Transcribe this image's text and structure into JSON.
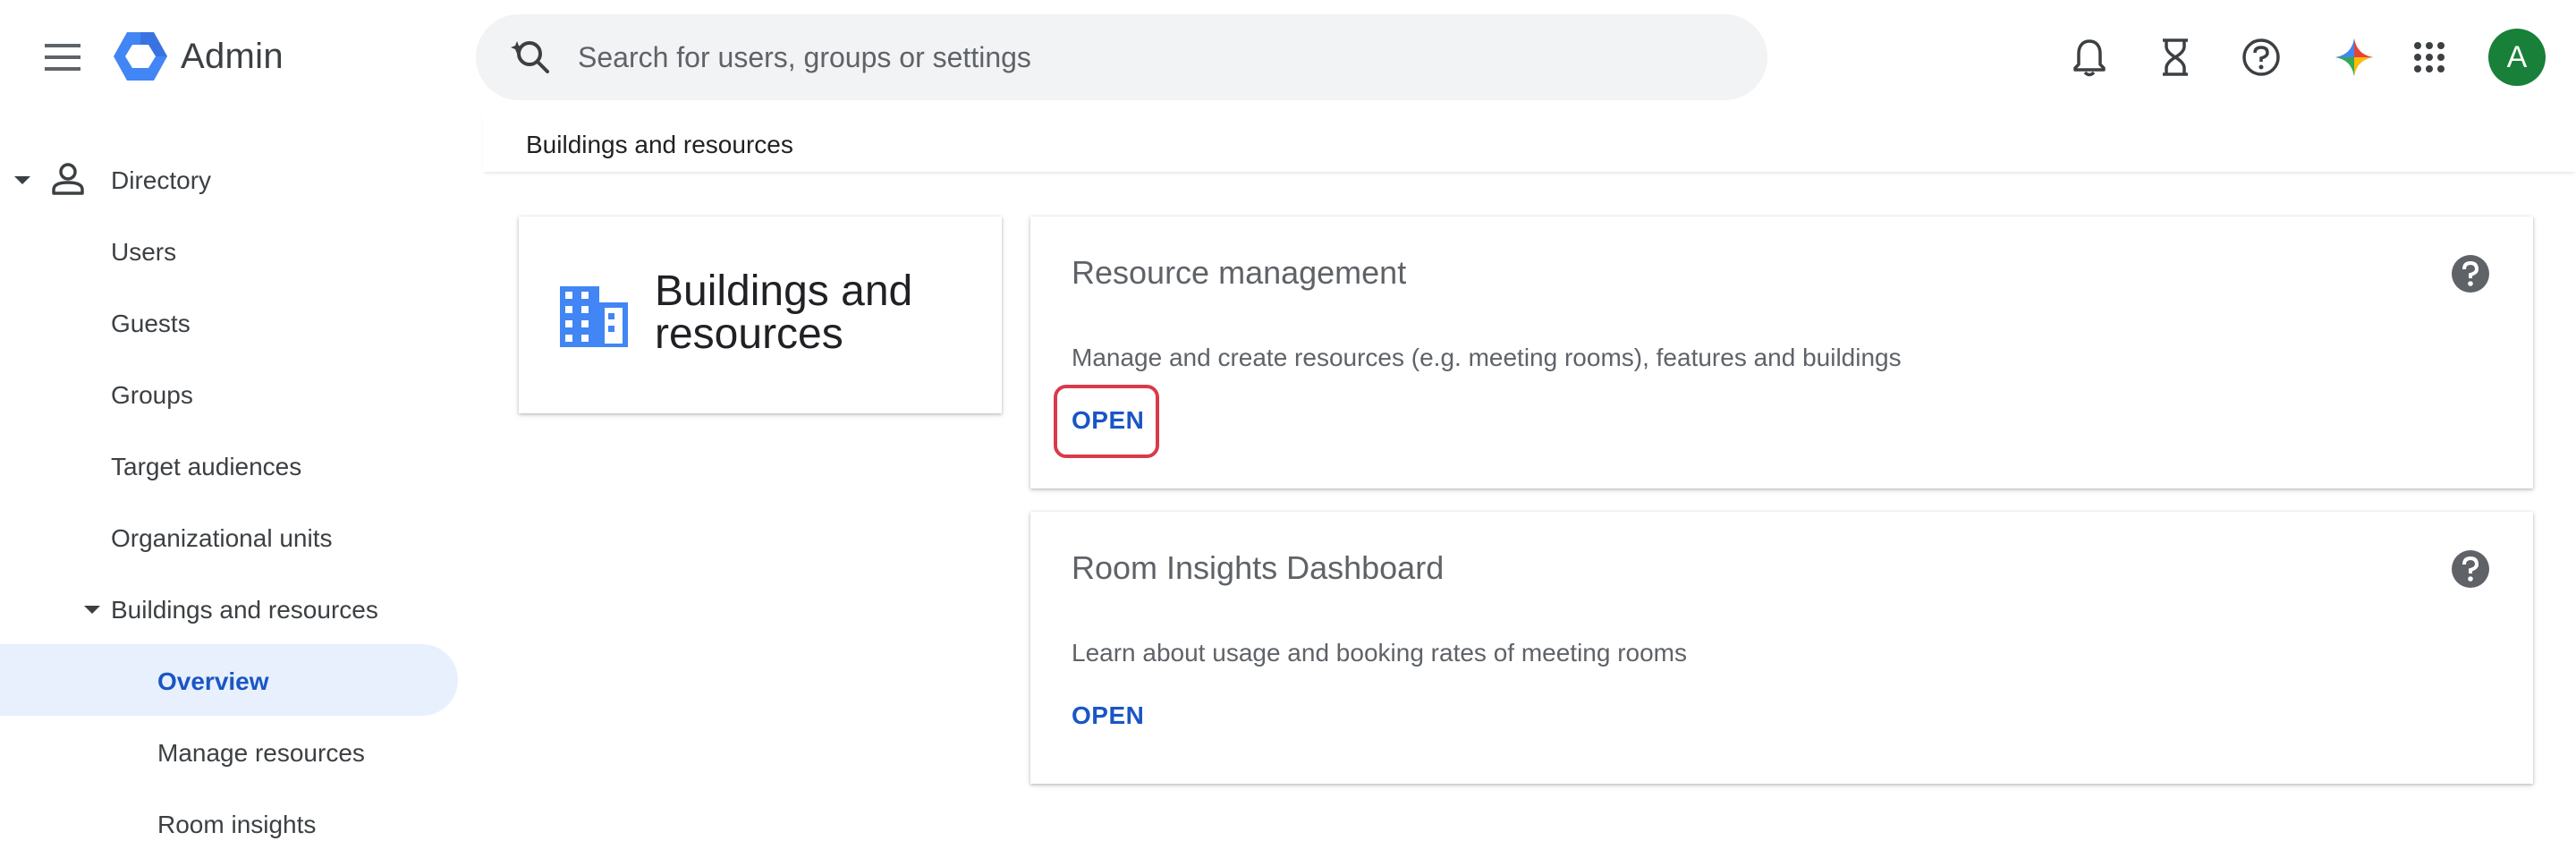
{
  "header": {
    "app_name": "Admin",
    "search_placeholder": "Search for users, groups or settings",
    "avatar_initial": "A",
    "avatar_color": "#188038"
  },
  "icons": [
    "menu-icon",
    "admin-logo-icon",
    "search-icon",
    "notifications-bell-icon",
    "tasks-hourglass-icon",
    "help-icon",
    "gemini-sparkle-icon",
    "apps-grid-icon",
    "building-icon",
    "help-icon"
  ],
  "sidebar": {
    "directory_label": "Directory",
    "items": [
      {
        "label": "Users"
      },
      {
        "label": "Guests"
      },
      {
        "label": "Groups"
      },
      {
        "label": "Target audiences"
      },
      {
        "label": "Organizational units"
      }
    ],
    "buildings": {
      "label": "Buildings and resources",
      "children": [
        {
          "label": "Overview",
          "selected": true
        },
        {
          "label": "Manage resources"
        },
        {
          "label": "Room insights"
        }
      ]
    }
  },
  "breadcrumb": "Buildings and resources",
  "title_card": {
    "title": "Buildings and resources"
  },
  "cards": [
    {
      "title": "Resource management",
      "description": "Manage and create resources (e.g. meeting rooms), features and buildings",
      "action": "OPEN",
      "highlighted": true
    },
    {
      "title": "Room Insights Dashboard",
      "description": "Learn about usage and booking rates of meeting rooms",
      "action": "OPEN",
      "highlighted": false
    }
  ],
  "colors": {
    "accent": "#1a56c4",
    "selected_bg": "#e8f0fe",
    "highlight": "#d93a4a",
    "building_icon": "#4285f4"
  }
}
